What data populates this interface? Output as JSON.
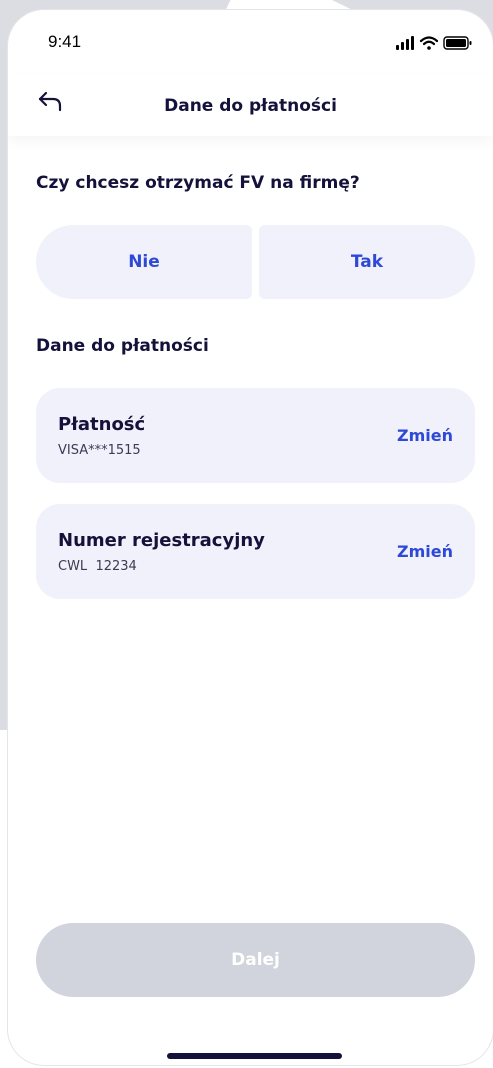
{
  "status_bar": {
    "time": "9:41"
  },
  "header": {
    "title": "Dane do płatności"
  },
  "invoice": {
    "question": "Czy chcesz otrzymać FV na firmę?",
    "options": [
      "Nie",
      "Tak"
    ]
  },
  "payment_section": {
    "title": "Dane do płatności",
    "cards": [
      {
        "title": "Płatność",
        "value": "VISA***1515",
        "action": "Zmień"
      },
      {
        "title": "Numer rejestracyjny",
        "value": "CWL  12234",
        "action": "Zmień"
      }
    ]
  },
  "footer": {
    "next_label": "Dalej",
    "next_disabled": true
  },
  "colors": {
    "accent": "#2e49d6",
    "text": "#14123a",
    "card_bg": "#f0f1fa",
    "button_disabled": "#d1d3dd"
  }
}
